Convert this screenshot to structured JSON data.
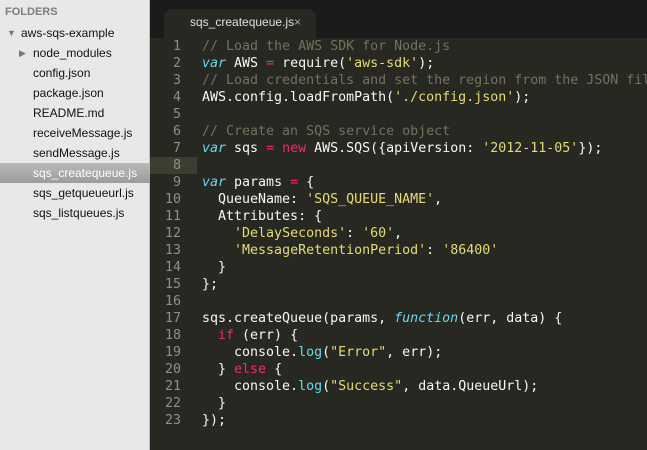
{
  "sidebar": {
    "header": "FOLDERS",
    "root": "aws-sqs-example",
    "items": [
      {
        "label": "node_modules",
        "type": "folder"
      },
      {
        "label": "config.json"
      },
      {
        "label": "package.json"
      },
      {
        "label": "README.md"
      },
      {
        "label": "receiveMessage.js"
      },
      {
        "label": "sendMessage.js"
      },
      {
        "label": "sqs_createqueue.js",
        "selected": true
      },
      {
        "label": "sqs_getqueueurl.js"
      },
      {
        "label": "sqs_listqueues.js"
      }
    ]
  },
  "tab": {
    "label": "sqs_createqueue.js",
    "close": "×"
  },
  "editor": {
    "current_line": 8,
    "lines": [
      [
        [
          "cmt",
          "// Load the AWS SDK for Node.js"
        ]
      ],
      [
        [
          "kw",
          "var"
        ],
        [
          "p",
          " AWS "
        ],
        [
          "op",
          "="
        ],
        [
          "p",
          " require("
        ],
        [
          "str",
          "'aws-sdk'"
        ],
        [
          "p",
          ");"
        ]
      ],
      [
        [
          "cmt",
          "// Load credentials and set the region from the JSON fil"
        ]
      ],
      [
        [
          "p",
          "AWS.config.loadFromPath("
        ],
        [
          "str",
          "'./config.json'"
        ],
        [
          "p",
          ");"
        ]
      ],
      [],
      [
        [
          "cmt",
          "// Create an SQS service object"
        ]
      ],
      [
        [
          "kw",
          "var"
        ],
        [
          "p",
          " sqs "
        ],
        [
          "op",
          "="
        ],
        [
          "p",
          " "
        ],
        [
          "op",
          "new"
        ],
        [
          "p",
          " AWS.SQS({apiVersion: "
        ],
        [
          "str",
          "'2012-11-05'"
        ],
        [
          "p",
          "});"
        ]
      ],
      [],
      [
        [
          "kw",
          "var"
        ],
        [
          "p",
          " params "
        ],
        [
          "op",
          "="
        ],
        [
          "p",
          " {"
        ]
      ],
      [
        [
          "p",
          "  QueueName: "
        ],
        [
          "str",
          "'SQS_QUEUE_NAME'"
        ],
        [
          "p",
          ","
        ]
      ],
      [
        [
          "p",
          "  Attributes: {"
        ]
      ],
      [
        [
          "p",
          "    "
        ],
        [
          "str",
          "'DelaySeconds'"
        ],
        [
          "p",
          ": "
        ],
        [
          "str",
          "'60'"
        ],
        [
          "p",
          ","
        ]
      ],
      [
        [
          "p",
          "    "
        ],
        [
          "str",
          "'MessageRetentionPeriod'"
        ],
        [
          "p",
          ": "
        ],
        [
          "str",
          "'86400'"
        ]
      ],
      [
        [
          "p",
          "  }"
        ]
      ],
      [
        [
          "p",
          "};"
        ]
      ],
      [],
      [
        [
          "p",
          "sqs.createQueue(params, "
        ],
        [
          "kw",
          "function"
        ],
        [
          "p",
          "(err, data) {"
        ]
      ],
      [
        [
          "p",
          "  "
        ],
        [
          "op",
          "if"
        ],
        [
          "p",
          " (err) {"
        ]
      ],
      [
        [
          "p",
          "    console."
        ],
        [
          "fn",
          "log"
        ],
        [
          "p",
          "("
        ],
        [
          "str",
          "\"Error\""
        ],
        [
          "p",
          ", err);"
        ]
      ],
      [
        [
          "p",
          "  } "
        ],
        [
          "op",
          "else"
        ],
        [
          "p",
          " {"
        ]
      ],
      [
        [
          "p",
          "    console."
        ],
        [
          "fn",
          "log"
        ],
        [
          "p",
          "("
        ],
        [
          "str",
          "\"Success\""
        ],
        [
          "p",
          ", data.QueueUrl);"
        ]
      ],
      [
        [
          "p",
          "  }"
        ]
      ],
      [
        [
          "p",
          "});"
        ]
      ]
    ]
  }
}
